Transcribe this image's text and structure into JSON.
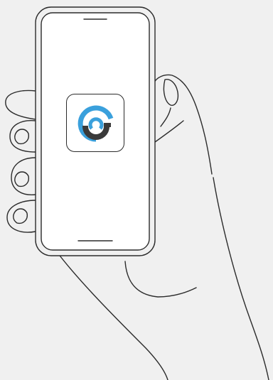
{
  "scene": {
    "background_color": "#f0f0f0",
    "line_color": "#2b2b2b",
    "phone_screen_color": "#ffffff"
  },
  "app_icon": {
    "icon_name": "app-logo-icon",
    "colors": {
      "accent_blue": "#3aa0dc",
      "dark_gray": "#3a3a3a",
      "tile_background": "#ffffff"
    }
  }
}
